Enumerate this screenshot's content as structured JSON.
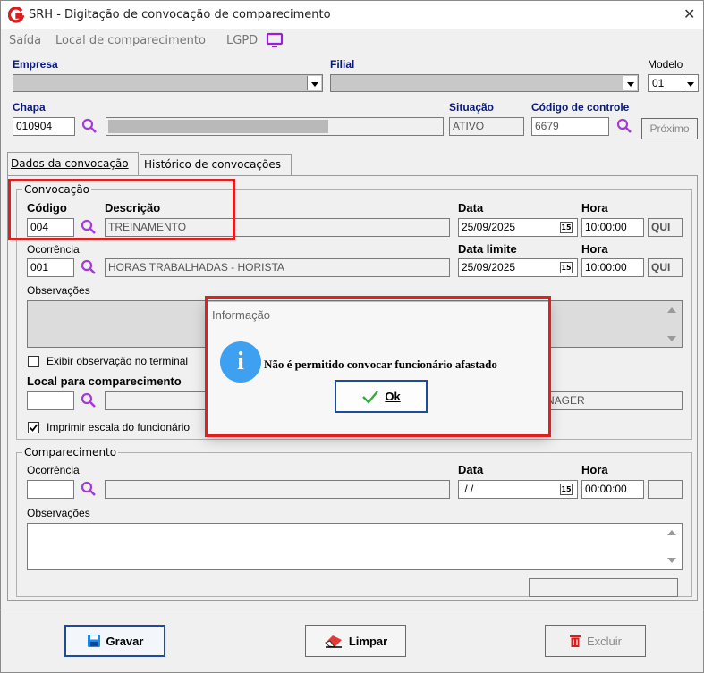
{
  "window": {
    "title": "SRH - Digitação de convocação de comparecimento"
  },
  "menu": {
    "saida": "Saída",
    "local": "Local de comparecimento",
    "lgpd": "LGPD"
  },
  "empresa": {
    "label": "Empresa"
  },
  "filial": {
    "label": "Filial"
  },
  "modelo": {
    "label": "Modelo",
    "value": "01"
  },
  "chapa": {
    "label": "Chapa",
    "value": "010904"
  },
  "situacao": {
    "label": "Situação",
    "value": "ATIVO"
  },
  "codigo_controle": {
    "label": "Código de controle",
    "value": "6679"
  },
  "proximo": {
    "label": "Próximo"
  },
  "tabs": [
    {
      "label": "Dados da convocação"
    },
    {
      "label": "Histórico de convocações"
    }
  ],
  "convocacao": {
    "group_title": "Convocação",
    "codigo_label": "Código",
    "codigo_value": "004",
    "descricao_label": "Descrição",
    "descricao_value": "TREINAMENTO",
    "data_label": "Data",
    "data_value": "25/09/2025",
    "hora_label": "Hora",
    "hora_value": "10:00:00",
    "dia_value": "QUI",
    "ocorrencia_label": "Ocorrência",
    "ocorrencia_code": "001",
    "ocorrencia_desc": "HORAS TRABALHADAS - HORISTA",
    "data_limite_label": "Data limite",
    "data_limite_value": "25/09/2025",
    "hora2_label": "Hora",
    "hora2_value": "10:00:00",
    "dia2_value": "QUI",
    "observacoes_label": "Observações",
    "exibir_obs_label": "Exibir observação no terminal",
    "local_label": "Local para comparecimento",
    "local_desc_value": "NAGER",
    "imprimir_label": "Imprimir escala do funcionário"
  },
  "comparecimento": {
    "group_title": "Comparecimento",
    "ocorrencia_label": "Ocorrência",
    "data_label": "Data",
    "data_value": " / /",
    "hora_label": "Hora",
    "hora_value": "00:00:00",
    "observacoes_label": "Observações"
  },
  "calendar_day": "15",
  "buttons": {
    "gravar": "Gravar",
    "limpar": "Limpar",
    "excluir": "Excluir"
  },
  "dialog": {
    "title": "Informação",
    "message": "Não é permitido convocar funcionário afastado",
    "ok_label": "Ok"
  },
  "colors": {
    "highlight": "#e02020",
    "accent": "#1f4c9a",
    "label_blue": "#0a1a7a"
  }
}
